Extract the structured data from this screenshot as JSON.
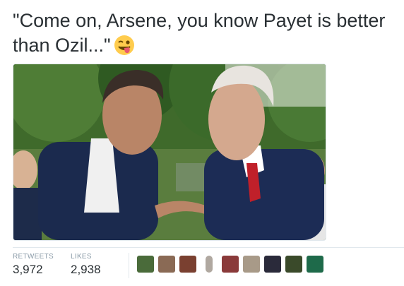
{
  "tweet": {
    "text": "\"Come on, Arsene, you know Payet is better than Ozil...\"",
    "emoji": "winking-face-with-tongue-emoji"
  },
  "media": {
    "icon": "photo-two-men-talking"
  },
  "stats": {
    "retweets_label": "RETWEETS",
    "retweets_value": "3,972",
    "likes_label": "LIKES",
    "likes_value": "2,938"
  },
  "likers": [
    {
      "icon": "avatar-team-crest",
      "color": "#4a6b3a"
    },
    {
      "icon": "avatar-person",
      "color": "#8a6a55"
    },
    {
      "icon": "avatar-person",
      "color": "#7a4030"
    },
    {
      "icon": "avatar-small-figure",
      "color": "#b0a8a0"
    },
    {
      "icon": "avatar-group",
      "color": "#8a3a3a"
    },
    {
      "icon": "avatar-person",
      "color": "#a89a88"
    },
    {
      "icon": "avatar-person-suit",
      "color": "#2a2a3a"
    },
    {
      "icon": "avatar-crowd",
      "color": "#3a4a2a"
    },
    {
      "icon": "avatar-logo",
      "color": "#1e6a4a"
    }
  ]
}
